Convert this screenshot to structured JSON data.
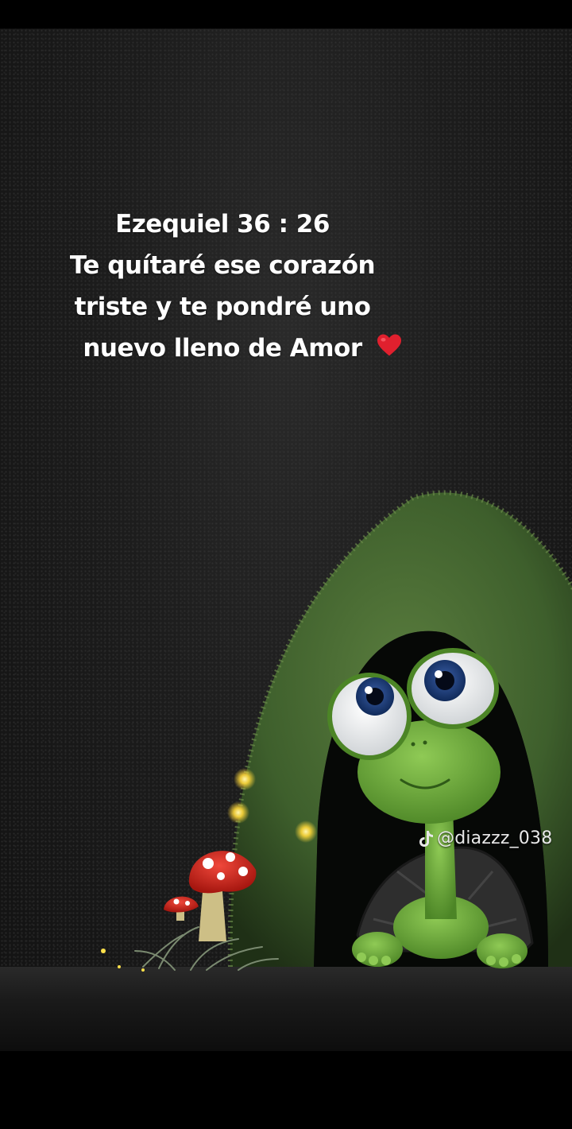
{
  "caption": {
    "lines": [
      "Ezequiel 36 : 26",
      "Te quítaré ese corazón",
      "triste y te pondré uno",
      "nuevo lleno de Amor"
    ],
    "emoji": "heart-emoji"
  },
  "watermark": {
    "icon": "tiktok-icon",
    "handle": "@diazzz_038"
  },
  "illustration": {
    "subject": "turtle",
    "elements": [
      "moss-arch",
      "red-mushroom",
      "small-red-mushroom",
      "glowing-fireflies",
      "grass-tuft"
    ]
  },
  "colors": {
    "background": "#1c1c1c",
    "moss": "#3e5f2c",
    "turtle_skin": "#6fa83a",
    "shell": "#2e2e2e",
    "mushroom_cap": "#d6281f",
    "firefly": "#ffe14a",
    "heart": "#e0202e",
    "text": "#ffffff"
  }
}
